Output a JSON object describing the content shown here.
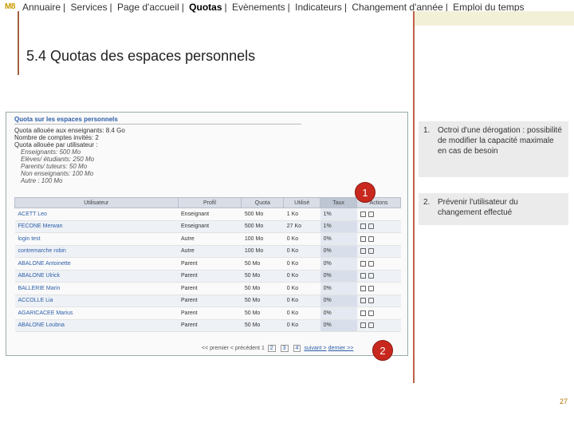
{
  "logo": "M8",
  "nav": {
    "items": [
      "Annuaire",
      "Services",
      "Page d'accueil",
      "Quotas",
      "Evènements",
      "Indicateurs",
      "Changement d'année",
      "Emploi du temps"
    ],
    "active": "Quotas"
  },
  "page_title": "5.4  Quotas des espaces personnels",
  "screenshot": {
    "title": "Quota sur les espaces personnels",
    "info_lines": [
      "Quota allouée aux enseignants: 8.4 Go",
      "Nombre de comptes invités: 2",
      "Quota allouée par utilisateur :"
    ],
    "info_italic": [
      "Enseignants: 500 Mo",
      "Elèves/ étudiants: 250 Mo",
      "Parents/ tuteurs: 50 Mo",
      "Non enseignants: 100 Mo",
      "Autre : 100 Mo"
    ],
    "columns": [
      "Utilisateur",
      "Profil",
      "Quota",
      "Utilisé",
      "Taux",
      "Actions"
    ],
    "rows": [
      {
        "name": "ACETT Leo",
        "profil": "Enseignant",
        "quota": "500 Mo",
        "used": "1 Ko",
        "taux": "1%"
      },
      {
        "name": "FECONE Merwan",
        "profil": "Enseignant",
        "quota": "500 Mo",
        "used": "27 Ko",
        "taux": "1%"
      },
      {
        "name": "login test",
        "profil": "Autre",
        "quota": "100 Mo",
        "used": "0 Ko",
        "taux": "0%"
      },
      {
        "name": "contremarche robin",
        "profil": "Autre",
        "quota": "100 Mo",
        "used": "0 Ko",
        "taux": "0%"
      },
      {
        "name": "ABALONE Antoinette",
        "profil": "Parent",
        "quota": "50 Mo",
        "used": "0 Ko",
        "taux": "0%"
      },
      {
        "name": "ABALONE Ulrick",
        "profil": "Parent",
        "quota": "50 Mo",
        "used": "0 Ko",
        "taux": "0%"
      },
      {
        "name": "BALLERIE Marin",
        "profil": "Parent",
        "quota": "50 Mo",
        "used": "0 Ko",
        "taux": "0%"
      },
      {
        "name": "ACCOLLE Lia",
        "profil": "Parent",
        "quota": "50 Mo",
        "used": "0 Ko",
        "taux": "0%"
      },
      {
        "name": "AGARICACEE Marius",
        "profil": "Parent",
        "quota": "50 Mo",
        "used": "0 Ko",
        "taux": "0%"
      },
      {
        "name": "ABALONE Loubna",
        "profil": "Parent",
        "quota": "50 Mo",
        "used": "0 Ko",
        "taux": "0%"
      }
    ],
    "pager": {
      "first": "<< premier",
      "prev": "< précédent",
      "pages": [
        "1",
        "2",
        "3",
        "4"
      ],
      "next": "suivant >",
      "last": "dernier >>"
    }
  },
  "badges": [
    "1",
    "2"
  ],
  "callouts": [
    {
      "num": "1.",
      "text": "Octroi d'une dérogation  : possibilité de modifier la capacité maximale en cas de besoin"
    },
    {
      "num": "2.",
      "text": "Prévenir l'utilisateur du changement effectué"
    }
  ],
  "page_number": "27"
}
